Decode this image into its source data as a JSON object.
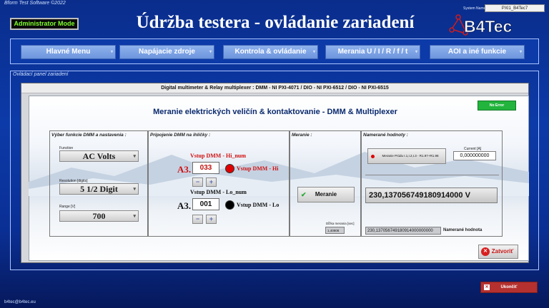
{
  "window": {
    "copyright": "Bform Test Software ©2022",
    "system_name_label": "System Name :",
    "system_name_value": "PXI1_B4Tec7",
    "admin_badge": "Administrator Mode",
    "title": "Údržba testera - ovládanie zariadení",
    "logo_text": "B4Tec",
    "footer_email": "b4tec@b4tec.eu"
  },
  "nav": {
    "items": [
      {
        "label": "Hlavné Menu"
      },
      {
        "label": "Napájacie zdroje"
      },
      {
        "label": "Kontrola & ovládanie"
      },
      {
        "label": "Merania U / I / R / f / t"
      },
      {
        "label": "AOI a iné funkcie"
      }
    ]
  },
  "panel": {
    "label": "Ovládací panel zariadení"
  },
  "dialog": {
    "header": "Digital multimeter & Relay multiplexer : DMM - NI PXI-4071 / DIO - NI PXI-6512 / DIO - NI PXI-6515",
    "subtitle": "Meranie elektrických veličín & kontaktovanie - DMM & Multiplexer",
    "status_button": "No Error",
    "status_color": "#22b43c",
    "dmm": {
      "section_title": "Výber funkcie DMM a nastavenia :",
      "function_label": "Function",
      "function_value": "AC Volts",
      "resolution_label": "Resolution [digits]",
      "resolution_value": "5 1/2 Digit",
      "range_label": "Range [V]",
      "range_value": "700"
    },
    "pins": {
      "section_title": "Pripojenie DMM na ihličky :",
      "hi_title": "Vstup DMM - Hi_num",
      "hi_prefix": "A3.",
      "hi_value": "033",
      "hi_led_label": "Vstup DMM - Hi",
      "hi_led_color": "#e00000",
      "lo_title": "Vstup DMM - Lo_num",
      "lo_prefix": "A3.",
      "lo_value": "001",
      "lo_led_label": "Vstup DMM - Lo",
      "lo_led_color": "#000000",
      "decrement_icon": "minus-icon",
      "increment_icon": "plus-icon"
    },
    "measure": {
      "section_title": "Meranie :",
      "button_label": "Meranie",
      "duration_label": "Dĺžka merania [sec]",
      "duration_value": "1,40908"
    },
    "results": {
      "section_title": "Namerané hodnoty :",
      "current_button": "Meranie Prúdu I.1,I.2,I.3 - R1.97+R1.98",
      "current_label": "Current [A]",
      "current_value": "0,000000000",
      "big_value": "230,137056749180914000 V",
      "raw_value": "230,137056749180914000000000",
      "raw_label": "Namerané hodnota"
    },
    "close_button": "Zatvoriť",
    "close_icon": "close-circle-icon"
  },
  "exit_button": "Ukončiť"
}
